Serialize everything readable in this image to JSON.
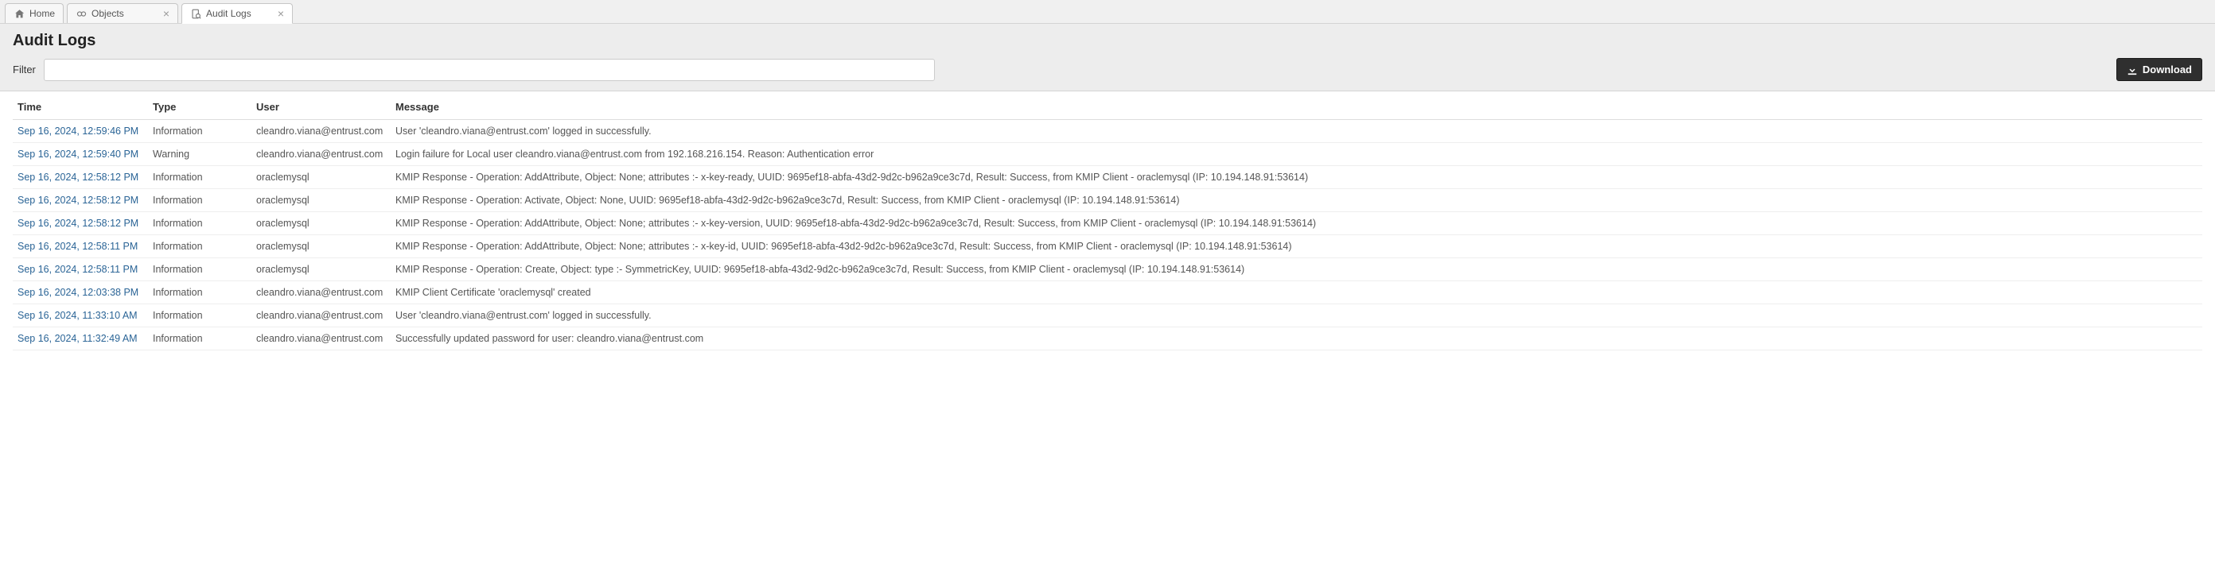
{
  "tabs": {
    "home": {
      "label": "Home"
    },
    "objects": {
      "label": "Objects"
    },
    "audit": {
      "label": "Audit Logs"
    }
  },
  "page": {
    "title": "Audit Logs",
    "filter_label": "Filter",
    "filter_value": "",
    "download_label": "Download"
  },
  "table": {
    "headers": {
      "time": "Time",
      "type": "Type",
      "user": "User",
      "message": "Message"
    },
    "rows": [
      {
        "time": "Sep 16, 2024, 12:59:46 PM",
        "type": "Information",
        "user": "cleandro.viana@entrust.com",
        "message": "User 'cleandro.viana@entrust.com' logged in successfully."
      },
      {
        "time": "Sep 16, 2024, 12:59:40 PM",
        "type": "Warning",
        "user": "cleandro.viana@entrust.com",
        "message": "Login failure for Local user cleandro.viana@entrust.com from 192.168.216.154. Reason: Authentication error"
      },
      {
        "time": "Sep 16, 2024, 12:58:12 PM",
        "type": "Information",
        "user": "oraclemysql",
        "message": "KMIP Response - Operation: AddAttribute, Object: None; attributes :- x-key-ready, UUID: 9695ef18-abfa-43d2-9d2c-b962a9ce3c7d, Result: Success, from KMIP Client - oraclemysql (IP: 10.194.148.91:53614)"
      },
      {
        "time": "Sep 16, 2024, 12:58:12 PM",
        "type": "Information",
        "user": "oraclemysql",
        "message": "KMIP Response - Operation: Activate, Object: None, UUID: 9695ef18-abfa-43d2-9d2c-b962a9ce3c7d, Result: Success, from KMIP Client - oraclemysql (IP: 10.194.148.91:53614)"
      },
      {
        "time": "Sep 16, 2024, 12:58:12 PM",
        "type": "Information",
        "user": "oraclemysql",
        "message": "KMIP Response - Operation: AddAttribute, Object: None; attributes :- x-key-version, UUID: 9695ef18-abfa-43d2-9d2c-b962a9ce3c7d, Result: Success, from KMIP Client - oraclemysql (IP: 10.194.148.91:53614)"
      },
      {
        "time": "Sep 16, 2024, 12:58:11 PM",
        "type": "Information",
        "user": "oraclemysql",
        "message": "KMIP Response - Operation: AddAttribute, Object: None; attributes :- x-key-id, UUID: 9695ef18-abfa-43d2-9d2c-b962a9ce3c7d, Result: Success, from KMIP Client - oraclemysql (IP: 10.194.148.91:53614)"
      },
      {
        "time": "Sep 16, 2024, 12:58:11 PM",
        "type": "Information",
        "user": "oraclemysql",
        "message": "KMIP Response - Operation: Create, Object: type :- SymmetricKey, UUID: 9695ef18-abfa-43d2-9d2c-b962a9ce3c7d, Result: Success, from KMIP Client - oraclemysql (IP: 10.194.148.91:53614)"
      },
      {
        "time": "Sep 16, 2024, 12:03:38 PM",
        "type": "Information",
        "user": "cleandro.viana@entrust.com",
        "message": "KMIP Client Certificate 'oraclemysql' created"
      },
      {
        "time": "Sep 16, 2024, 11:33:10 AM",
        "type": "Information",
        "user": "cleandro.viana@entrust.com",
        "message": "User 'cleandro.viana@entrust.com' logged in successfully."
      },
      {
        "time": "Sep 16, 2024, 11:32:49 AM",
        "type": "Information",
        "user": "cleandro.viana@entrust.com",
        "message": "Successfully updated password for user: cleandro.viana@entrust.com"
      }
    ]
  }
}
